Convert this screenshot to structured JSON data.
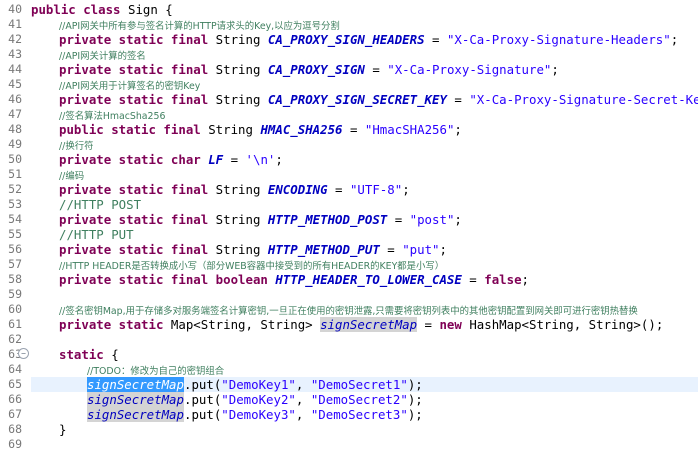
{
  "gutter": {
    "line_numbers": [
      "40",
      "41",
      "42",
      "43",
      "44",
      "45",
      "46",
      "47",
      "48",
      "49",
      "50",
      "51",
      "52",
      "53",
      "54",
      "55",
      "56",
      "57",
      "58",
      "59",
      "60",
      "61",
      "62",
      "63",
      "64",
      "65",
      "66",
      "67",
      "68",
      "69"
    ],
    "fold_marker": "−"
  },
  "code": {
    "l40": {
      "kw": "public class",
      "rest": " Sign {"
    },
    "l41": {
      "comment": "//API网关中所有参与签名计算的HTTP请求头的Key,以应为逗号分割"
    },
    "l42": {
      "kw": "private static final",
      "type": " String ",
      "name": "CA_PROXY_SIGN_HEADERS",
      "eq": " = ",
      "str": "\"X-Ca-Proxy-Signature-Headers\"",
      "end": ";"
    },
    "l43": {
      "comment": "//API网关计算的签名"
    },
    "l44": {
      "kw": "private static final",
      "type": " String ",
      "name": "CA_PROXY_SIGN",
      "eq": " = ",
      "str": "\"X-Ca-Proxy-Signature\"",
      "end": ";"
    },
    "l45": {
      "comment": "//API网关用于计算签名的密钥Key"
    },
    "l46": {
      "kw": "private static final",
      "type": " String ",
      "name": "CA_PROXY_SIGN_SECRET_KEY",
      "eq": " = ",
      "str": "\"X-Ca-Proxy-Signature-Secret-Key\"",
      "end": ";"
    },
    "l47": {
      "comment": "//签名算法HmacSha256"
    },
    "l48": {
      "kw": "public static final",
      "type": " String ",
      "name": "HMAC_SHA256",
      "eq": " = ",
      "str": "\"HmacSHA256\"",
      "end": ";"
    },
    "l49": {
      "comment": "//换行符"
    },
    "l50": {
      "kw": "private static char",
      "type": " ",
      "name": "LF",
      "eq": " = ",
      "str": "'\\n'",
      "end": ";"
    },
    "l51": {
      "comment": "//编码"
    },
    "l52": {
      "kw": "private static final",
      "type": " String ",
      "name": "ENCODING",
      "eq": " = ",
      "str": "\"UTF-8\"",
      "end": ";"
    },
    "l53": {
      "comment": "//HTTP POST"
    },
    "l54": {
      "kw": "private static final",
      "type": " String ",
      "name": "HTTP_METHOD_POST",
      "eq": " = ",
      "str": "\"post\"",
      "end": ";"
    },
    "l55": {
      "comment": "//HTTP PUT"
    },
    "l56": {
      "kw": "private static final",
      "type": " String ",
      "name": "HTTP_METHOD_PUT",
      "eq": " = ",
      "str": "\"put\"",
      "end": ";"
    },
    "l57": {
      "comment": "//HTTP HEADER是否转换成小写（部分WEB容器中接受到的所有HEADER的KEY都是小写）"
    },
    "l58": {
      "kw": "private static final boolean",
      "type": " ",
      "name": "HTTP_HEADER_TO_LOWER_CASE",
      "eq": " = ",
      "kw2": "false",
      "end": ";"
    },
    "l60": {
      "comment": "//签名密钥Map,用于存储多对服务端签名计算密钥,一旦正在使用的密钥泄露,只需要将密钥列表中的其他密钥配置到网关即可进行密钥热替换"
    },
    "l61": {
      "kw": "private static",
      "type": " Map<String, String> ",
      "name": "signSecretMap",
      "eq": " = ",
      "kw2": "new",
      "end": " HashMap<String, String>();"
    },
    "l63": {
      "kw": "static",
      "rest": " {"
    },
    "l64": {
      "comment": "//TODO：修改为自己的密钥组合"
    },
    "l65": {
      "name": "signSecretMap",
      "call": ".put(",
      "str1": "\"DemoKey1\"",
      "sep": ", ",
      "str2": "\"DemoSecret1\"",
      "end": ");"
    },
    "l66": {
      "name": "signSecretMap",
      "call": ".put(",
      "str1": "\"DemoKey2\"",
      "sep": ", ",
      "str2": "\"DemoSecret2\"",
      "end": ");"
    },
    "l67": {
      "name": "signSecretMap",
      "call": ".put(",
      "str1": "\"DemoKey3\"",
      "sep": ", ",
      "str2": "\"DemoSecret3\"",
      "end": ");"
    },
    "l68": {
      "rest": "}"
    }
  },
  "colors": {
    "keyword": "#7f0055",
    "string": "#2a00ff",
    "comment": "#3f7f5f",
    "static_field": "#0000c0",
    "selection": "#3399ff",
    "occurrence": "#d4d4d4"
  }
}
